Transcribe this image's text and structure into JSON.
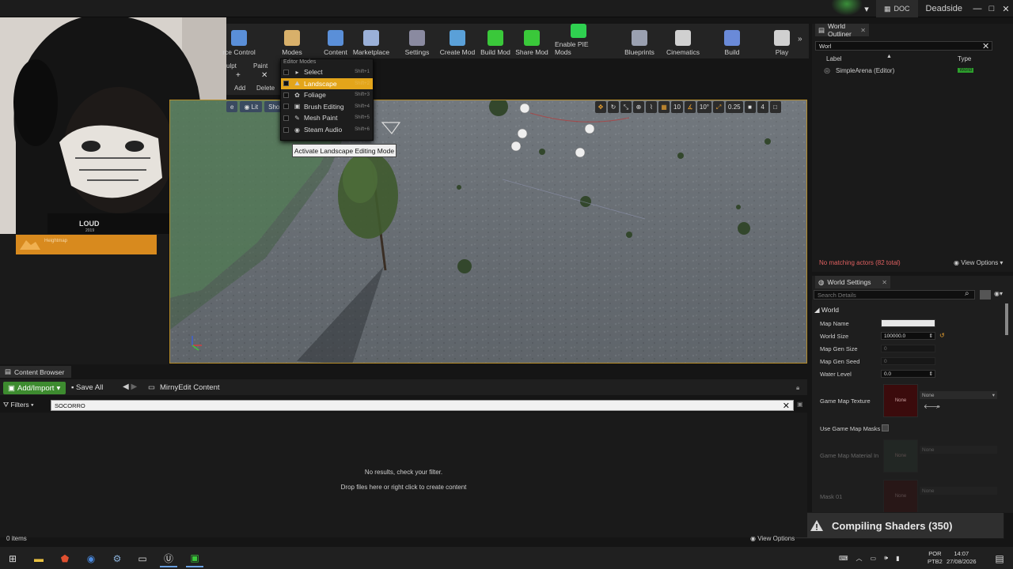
{
  "titlebar": {
    "project_tab": "DOC",
    "project_name": "Deadside",
    "minimize": "—",
    "maximize": "□",
    "close": "✕"
  },
  "toolbar": {
    "items": [
      {
        "label": "rce Control",
        "color": "#5a8fd8"
      },
      {
        "label": "Modes",
        "color": "#d8b06a"
      },
      {
        "label": "Content",
        "color": "#5a8fd8"
      },
      {
        "label": "Marketplace",
        "color": "#9ab0d8"
      },
      {
        "label": "Settings",
        "color": "#8a8aa0"
      },
      {
        "label": "Create Mod",
        "color": "#5aa0d8"
      },
      {
        "label": "Build Mod",
        "color": "#3ac83a"
      },
      {
        "label": "Share Mod",
        "color": "#3ac83a"
      },
      {
        "label": "Enable PIE Mods",
        "color": "#2fd050"
      },
      {
        "label": "Blueprints",
        "color": "#9aa0b0"
      },
      {
        "label": "Cinematics",
        "color": "#d0d0d0"
      },
      {
        "label": "Build",
        "color": "#6a8ad8"
      },
      {
        "label": "Play",
        "color": "#d0d0d0"
      }
    ]
  },
  "mode_panel": {
    "tab_sculpt": "ulpt",
    "tab_paint": "Paint",
    "add": "Add",
    "delete": "Delete"
  },
  "modes_menu": {
    "header": "Editor Modes",
    "items": [
      {
        "label": "Select",
        "shortcut": "Shift+1",
        "icon": "▸",
        "active": false
      },
      {
        "label": "Landscape",
        "shortcut": "Shift+2",
        "icon": "⛰",
        "active": true
      },
      {
        "label": "Foliage",
        "shortcut": "Shift+3",
        "icon": "✿",
        "active": false
      },
      {
        "label": "Brush Editing",
        "shortcut": "Shift+4",
        "icon": "▣",
        "active": false
      },
      {
        "label": "Mesh Paint",
        "shortcut": "Shift+5",
        "icon": "✎",
        "active": false
      },
      {
        "label": "Steam Audio",
        "shortcut": "Shift+6",
        "icon": "◉",
        "active": false
      }
    ],
    "tooltip": "Activate Landscape Editing Mode"
  },
  "viewport": {
    "btn_view": "e",
    "btn_lit": "Lit",
    "btn_show": "Sho",
    "snap_grid": "10",
    "snap_rot": "10°",
    "snap_scale": "0.25",
    "cam_speed": "4"
  },
  "left_panel": {
    "heightmap_label": "Heightmap"
  },
  "webcam": {
    "brand": "LOUD",
    "year": "2019"
  },
  "outliner": {
    "tab": "World Outliner",
    "search_value": "Worl",
    "col_label": "Label",
    "col_type": "Type",
    "row_label": "SimpleArena (Editor)",
    "row_type": "World",
    "no_match": "No matching actors (82 total)",
    "view_options": "View Options"
  },
  "world_settings": {
    "tab": "World Settings",
    "search_placeholder": "Search Details",
    "section": "World",
    "map_name": "Map Name",
    "world_size": "World Size",
    "world_size_value": "100000.0",
    "map_gen_size": "Map Gen Size",
    "map_gen_size_value": "0",
    "map_gen_seed": "Map Gen Seed",
    "map_gen_seed_value": "0",
    "water_level": "Water Level",
    "water_level_value": "0.0",
    "game_map_texture": "Game Map Texture",
    "swatch_none": "None",
    "dropdown_none": "None",
    "use_masks": "Use Game Map Masks",
    "game_map_material": "Game Map Material In",
    "mask01": "Mask 01"
  },
  "compiling": "Compiling Shaders (350)",
  "content_browser": {
    "tab": "Content Browser",
    "add_import": "Add/Import",
    "save_all": "Save All",
    "path": "MirnyEdit Content",
    "filters": "Filters",
    "search_value": "SOCORRO",
    "no_results": "No results, check your filter.",
    "drop_files": "Drop files here or right click to create content",
    "item_count": "0 items",
    "view_options": "View Options"
  },
  "taskbar": {
    "lang1": "POR",
    "lang2": "PTB2",
    "time": "14:07",
    "date": "27/08/2026"
  },
  "colors": {
    "accent": "#e3a51a",
    "addimport": "#3d8b2f",
    "error": "#e06060"
  }
}
